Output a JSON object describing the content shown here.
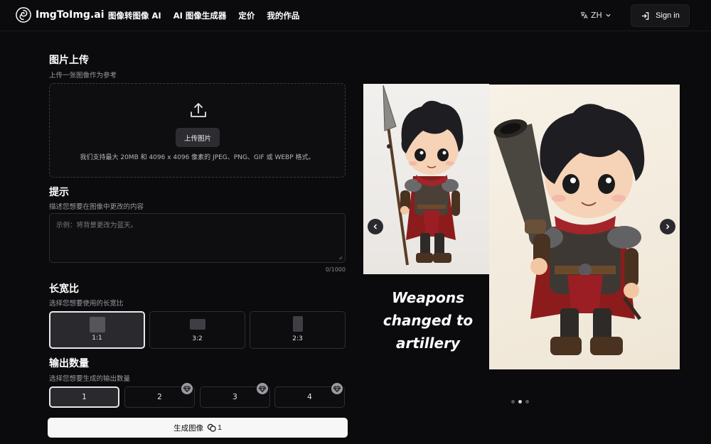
{
  "header": {
    "logo_text": "ImgToImg.ai",
    "nav": [
      "图像转图像 AI",
      "AI 图像生成器",
      "定价",
      "我的作品"
    ],
    "lang": "ZH",
    "signin": "Sign in"
  },
  "upload": {
    "title": "图片上传",
    "desc": "上传一张图像作为参考",
    "button": "上传图片",
    "hint": "我们支持最大 20MB 和 4096 x 4096 像素的 JPEG、PNG、GIF 或 WEBP 格式。"
  },
  "prompt": {
    "title": "提示",
    "desc": "描述您想要在图像中更改的内容",
    "placeholder": "示例：将背景更改为蓝天。",
    "count": "0/1000"
  },
  "ratio": {
    "title": "长宽比",
    "desc": "选择您想要使用的长宽比",
    "options": [
      "1:1",
      "3:2",
      "2:3"
    ],
    "selected": "1:1"
  },
  "output": {
    "title": "输出数量",
    "desc": "选择您想要生成的输出数量",
    "options": [
      "1",
      "2",
      "3",
      "4"
    ],
    "selected": "1"
  },
  "generate": {
    "label": "生成图像",
    "cost": "1"
  },
  "showcase": {
    "caption_lines": [
      "Weapons",
      "changed to",
      "artillery"
    ],
    "slides": 3,
    "active_slide": 2
  },
  "icons": {
    "logo": "swirl-logo-icon",
    "lang": "translate-icon",
    "signin": "login-icon",
    "upload": "upload-icon",
    "premium": "diamond-icon",
    "credits": "coins-icon",
    "prev": "chevron-left-icon",
    "next": "chevron-right-icon"
  }
}
